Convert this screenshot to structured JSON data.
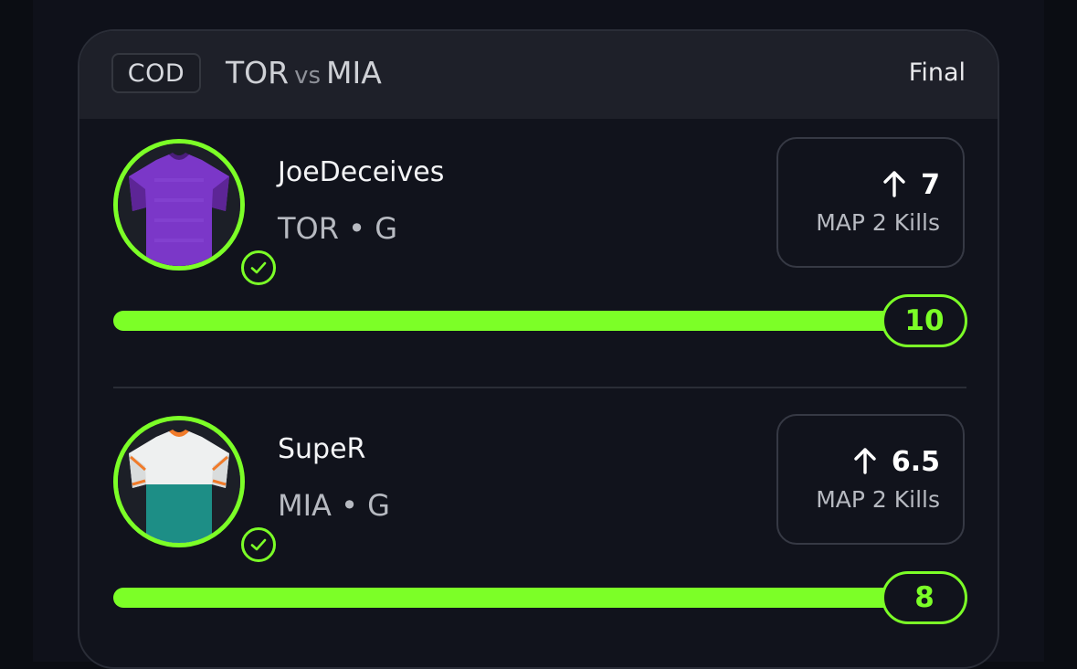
{
  "match": {
    "game": "COD",
    "home": "TOR",
    "vs": "vs",
    "away": "MIA",
    "status": "Final"
  },
  "players": [
    {
      "name": "JoeDeceives",
      "team": "TOR",
      "position": "G",
      "meta": "TOR • G",
      "direction_icon": "arrow-up-icon",
      "line": "7",
      "stat": "MAP 2 Kills",
      "result": "10",
      "progress_fraction": 1.0,
      "jersey_colors": {
        "primary": "#7b37c8",
        "shade": "#5d2596",
        "collar": "#4a1d7a"
      },
      "avatar_icon": "purple-jersey-icon",
      "badge_icon": "check-icon"
    },
    {
      "name": "SupeR",
      "team": "MIA",
      "position": "G",
      "meta": "MIA • G",
      "direction_icon": "arrow-up-icon",
      "line": "6.5",
      "stat": "MAP 2 Kills",
      "result": "8",
      "progress_fraction": 1.0,
      "jersey_colors": {
        "primary": "#eef0f0",
        "secondary": "#1d8e86",
        "accent": "#f07b2a"
      },
      "avatar_icon": "teal-white-jersey-icon",
      "badge_icon": "check-icon"
    }
  ],
  "colors": {
    "accent_green": "#7cff27",
    "card_bg": "#11131c",
    "header_bg": "#1e2029",
    "page_bg": "#0b0d13"
  }
}
